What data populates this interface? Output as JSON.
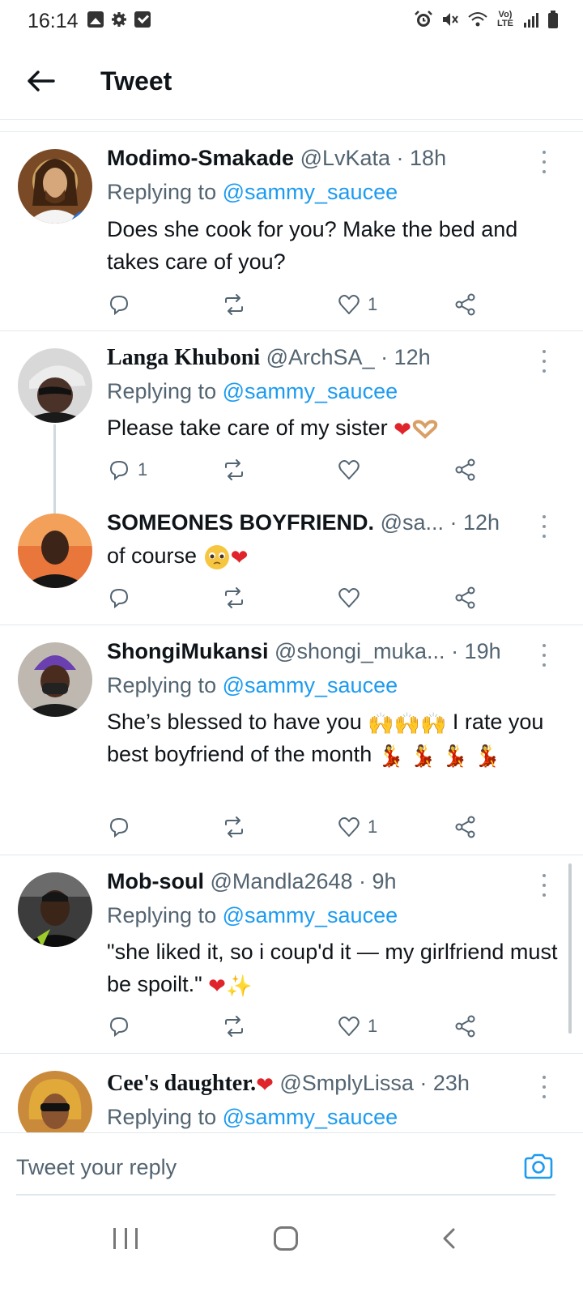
{
  "status_bar": {
    "time": "16:14",
    "lte_label": "Vo) LTE"
  },
  "header": {
    "title": "Tweet"
  },
  "tweets": [
    {
      "name": "Modimo-Smakade",
      "handle": "@LvKata",
      "time": "· 18h",
      "replying_prefix": "Replying to",
      "replying_to": "@sammy_saucee",
      "text": "Does she cook for you? Make the bed and takes care of you?",
      "reply_count": "",
      "like_count": "1"
    },
    {
      "name": "Langa Khuboni",
      "handle": "@ArchSA_",
      "time": "· 12h",
      "replying_prefix": "Replying to",
      "replying_to": "@sammy_saucee",
      "text": "Please take care of my sister",
      "reply_count": "1",
      "like_count": ""
    },
    {
      "name": "SOMEONES BOYFRIEND.",
      "handle": "@sa...",
      "time": "· 12h",
      "text": "of course",
      "reply_count": "",
      "like_count": ""
    },
    {
      "name": "ShongiMukansi",
      "handle": "@shongi_muka...",
      "time": "· 19h",
      "replying_prefix": "Replying to",
      "replying_to": "@sammy_saucee",
      "text_part1": "She’s blessed to have you",
      "text_part2": "I rate you best boyfriend of the month",
      "reply_count": "",
      "like_count": "1"
    },
    {
      "name": "Mob-soul",
      "handle": "@Mandla2648",
      "time": "· 9h",
      "replying_prefix": "Replying to",
      "replying_to": "@sammy_saucee",
      "text": "\"she liked it, so i coup'd it — my girlfriend must be spoilt.\"",
      "reply_count": "",
      "like_count": "1"
    },
    {
      "name": "Cee's daughter.",
      "handle": "@SmplyLissa",
      "time": "· 23h",
      "replying_prefix": "Replying to",
      "replying_to": "@sammy_saucee"
    }
  ],
  "composer": {
    "placeholder": "Tweet your reply"
  },
  "colors": {
    "accent": "#1d9bf0",
    "text_secondary": "#536471",
    "heart": "#e0242b"
  },
  "icons": [
    "back-arrow-icon",
    "more-icon",
    "reply-icon",
    "retweet-icon",
    "like-icon",
    "share-icon",
    "camera-icon"
  ]
}
